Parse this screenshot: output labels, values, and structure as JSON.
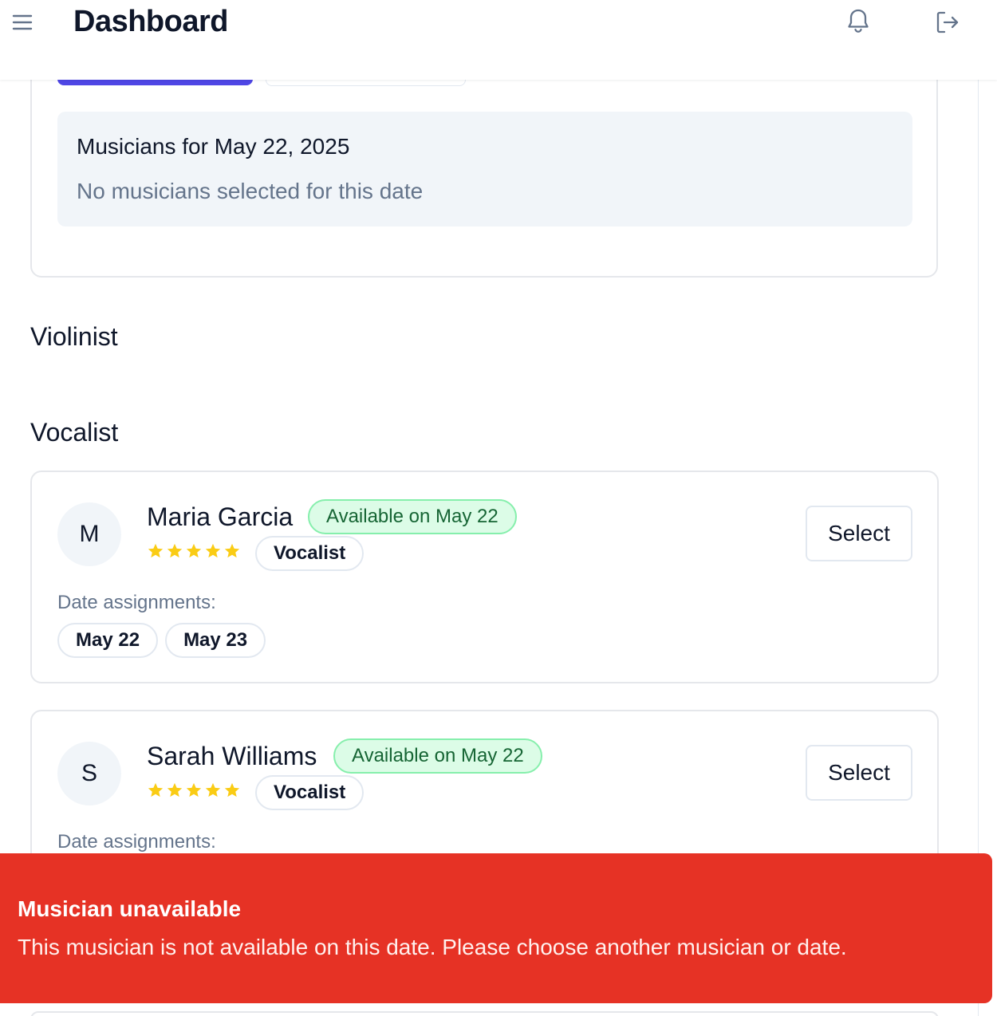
{
  "header": {
    "title": "Dashboard",
    "menu_icon": "hamburger-menu-icon",
    "notifications_icon": "bell-icon",
    "logout_icon": "logout-icon"
  },
  "date_panel": {
    "title": "Musicians for May 22, 2025",
    "empty_text": "No musicians selected for this date"
  },
  "sections": {
    "violinist": "Violinist",
    "vocalist": "Vocalist"
  },
  "musicians": [
    {
      "initial": "M",
      "name": "Maria Garcia",
      "availability": "Available on May 22",
      "rating": 5,
      "role": "Vocalist",
      "select_label": "Select",
      "assignments_label": "Date assignments:",
      "assignments": [
        "May 22",
        "May 23"
      ]
    },
    {
      "initial": "S",
      "name": "Sarah Williams",
      "availability": "Available on May 22",
      "rating": 5,
      "role": "Vocalist",
      "select_label": "Select",
      "assignments_label": "Date assignments:"
    }
  ],
  "toast": {
    "title": "Musician unavailable",
    "message": "This musician is not available on this date. Please choose another musician or date."
  },
  "colors": {
    "primary": "#4f46e5",
    "available_bg": "#dcfce7",
    "available_text": "#166534",
    "star": "#facc15",
    "toast_bg": "#e63225"
  }
}
